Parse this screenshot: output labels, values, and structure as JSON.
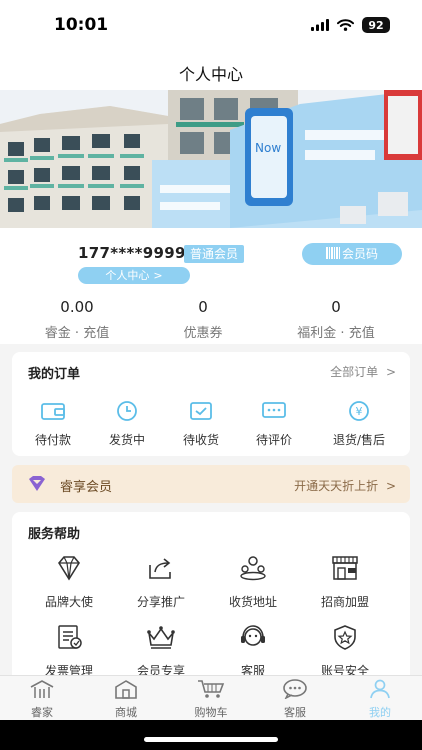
{
  "status_bar": {
    "time": "10:01",
    "battery": "92"
  },
  "header": {
    "title": "个人中心"
  },
  "profile": {
    "phone": "177****9999",
    "level": "普通会员",
    "center_link": "个人中心",
    "member_code": "会员码",
    "stats": [
      {
        "value": "0.00",
        "label": "睿金 · 充值"
      },
      {
        "value": "0",
        "label": "优惠券"
      },
      {
        "value": "0",
        "label": "福利金 · 充值"
      }
    ]
  },
  "orders": {
    "title": "我的订单",
    "all_link": "全部订单",
    "items": [
      {
        "label": "待付款",
        "icon": "wallet-icon"
      },
      {
        "label": "发货中",
        "icon": "clock-icon"
      },
      {
        "label": "待收货",
        "icon": "package-check-icon"
      },
      {
        "label": "待评价",
        "icon": "chat-dots-icon"
      },
      {
        "label": "退货/售后",
        "icon": "yuan-refund-icon"
      }
    ]
  },
  "vip": {
    "title": "睿享会员",
    "action": "开通天天折上折"
  },
  "services": {
    "title": "服务帮助",
    "items": [
      {
        "label": "品牌大使",
        "icon": "diamond-icon"
      },
      {
        "label": "分享推广",
        "icon": "share-icon"
      },
      {
        "label": "收货地址",
        "icon": "location-people-icon"
      },
      {
        "label": "招商加盟",
        "icon": "storefront-icon"
      },
      {
        "label": "发票管理",
        "icon": "invoice-icon"
      },
      {
        "label": "会员专享",
        "icon": "crown-icon"
      },
      {
        "label": "客服",
        "icon": "headset-icon"
      },
      {
        "label": "账号安全",
        "icon": "shield-star-icon"
      }
    ]
  },
  "tabbar": {
    "items": [
      {
        "label": "睿家",
        "icon": "home-roof-icon"
      },
      {
        "label": "商城",
        "icon": "shop-icon"
      },
      {
        "label": "购物车",
        "icon": "cart-icon"
      },
      {
        "label": "客服",
        "icon": "chat-icon"
      },
      {
        "label": "我的",
        "icon": "person-icon"
      }
    ],
    "active_index": 4
  },
  "colors": {
    "accent": "#8fd0f2",
    "vip_bg": "#f8ebda",
    "vip_text": "#6b4a24",
    "page_bg": "#f4f4f4"
  }
}
